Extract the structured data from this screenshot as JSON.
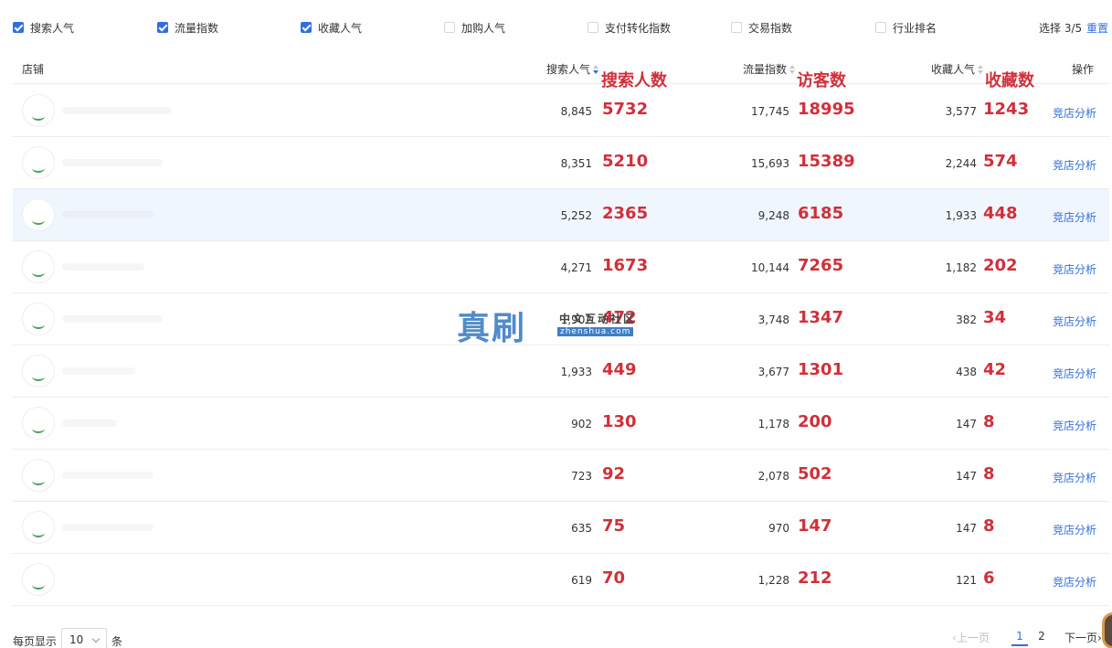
{
  "filters": [
    {
      "label": "搜索人气",
      "checked": true
    },
    {
      "label": "流量指数",
      "checked": true
    },
    {
      "label": "收藏人气",
      "checked": true
    },
    {
      "label": "加购人气",
      "checked": false
    },
    {
      "label": "支付转化指数",
      "checked": false
    },
    {
      "label": "交易指数",
      "checked": false
    },
    {
      "label": "行业排名",
      "checked": false
    }
  ],
  "selection": {
    "count_text": "选择 3/5",
    "reset_label": "重置"
  },
  "table": {
    "headers": {
      "shop": "店铺",
      "search": "搜索人气",
      "traffic": "流量指数",
      "fav": "收藏人气",
      "op": "操作"
    },
    "annotations": {
      "search": "搜索人数",
      "traffic": "访客数",
      "fav": "收藏数"
    },
    "action_label": "竞店分析",
    "rows": [
      {
        "search": "8,845",
        "search_est": "5732",
        "traffic": "17,745",
        "traffic_est": "18995",
        "fav": "3,577",
        "fav_est": "1243"
      },
      {
        "search": "8,351",
        "search_est": "5210",
        "traffic": "15,693",
        "traffic_est": "15389",
        "fav": "2,244",
        "fav_est": "574"
      },
      {
        "search": "5,252",
        "search_est": "2365",
        "traffic": "9,248",
        "traffic_est": "6185",
        "fav": "1,933",
        "fav_est": "448",
        "highlighted": true
      },
      {
        "search": "4,271",
        "search_est": "1673",
        "traffic": "10,144",
        "traffic_est": "7265",
        "fav": "1,182",
        "fav_est": "202"
      },
      {
        "search": "1,902",
        "search_est": "472",
        "traffic": "3,748",
        "traffic_est": "1347",
        "fav": "382",
        "fav_est": "34"
      },
      {
        "search": "1,933",
        "search_est": "449",
        "traffic": "3,677",
        "traffic_est": "1301",
        "fav": "438",
        "fav_est": "42"
      },
      {
        "search": "902",
        "search_est": "130",
        "traffic": "1,178",
        "traffic_est": "200",
        "fav": "147",
        "fav_est": "8"
      },
      {
        "search": "723",
        "search_est": "92",
        "traffic": "2,078",
        "traffic_est": "502",
        "fav": "147",
        "fav_est": "8"
      },
      {
        "search": "635",
        "search_est": "75",
        "traffic": "970",
        "traffic_est": "147",
        "fav": "147",
        "fav_est": "8"
      },
      {
        "search": "619",
        "search_est": "70",
        "traffic": "1,228",
        "traffic_est": "212",
        "fav": "121",
        "fav_est": "6"
      }
    ]
  },
  "watermark": {
    "main": "真刷",
    "sub_cn": "中文互动社区",
    "sub_en": "zhenshua.com"
  },
  "footer": {
    "per_page_label": "每页显示",
    "per_page_value": "10",
    "per_page_unit": "条",
    "prev_label": "上一页",
    "pages": [
      "1",
      "2"
    ],
    "current_page": "1",
    "next_label": "下一页"
  },
  "colors": {
    "accent": "#2f6fe0",
    "annotation": "#d0303a",
    "highlight_row": "#f0f6fe"
  }
}
